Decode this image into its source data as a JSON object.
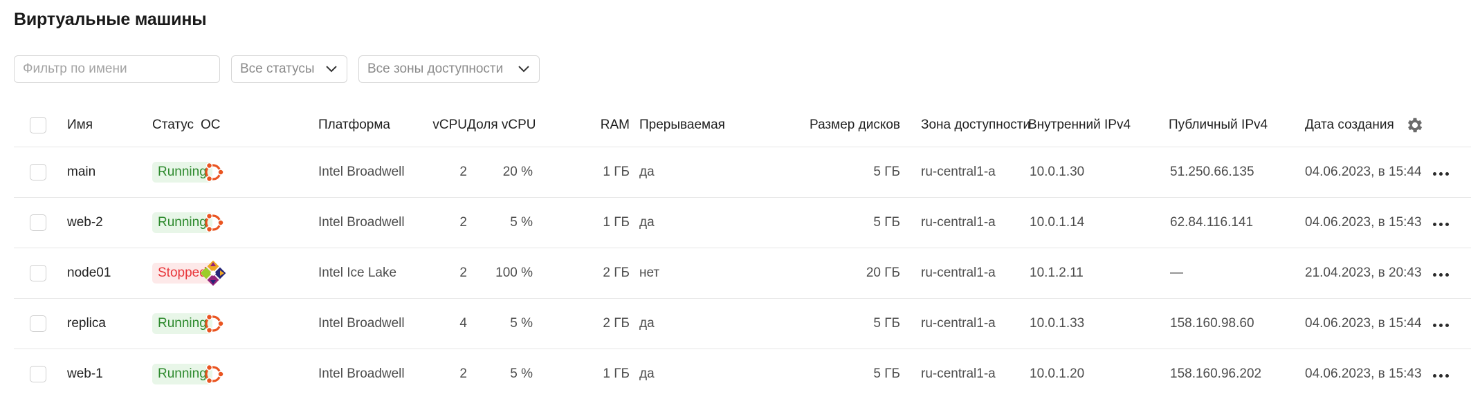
{
  "page_title": "Виртуальные машины",
  "filters": {
    "name_placeholder": "Фильтр по имени",
    "status_label": "Все статусы",
    "zone_label": "Все зоны доступности"
  },
  "columns": {
    "name": "Имя",
    "status": "Статус",
    "os": "ОС",
    "platform": "Платформа",
    "vcpu": "vCPU",
    "vcpu_share": "Доля vCPU",
    "ram": "RAM",
    "preemptible": "Прерываемая",
    "disk_size": "Размер дисков",
    "zone": "Зона доступности",
    "internal_ip": "Внутренний IPv4",
    "public_ip": "Публичный IPv4",
    "created": "Дата создания"
  },
  "colors": {
    "running_bg": "#e8f6e8",
    "running_text": "#2d8a2d",
    "stopped_bg": "#fde9e9",
    "stopped_text": "#e8363a",
    "ubuntu_orange": "#e95420"
  },
  "rows": [
    {
      "name": "main",
      "status": "Running",
      "os": "ubuntu-icon",
      "platform": "Intel Broadwell",
      "vcpu": "2",
      "vcpu_share": "20 %",
      "ram": "1 ГБ",
      "preemptible": "да",
      "disk_size": "5 ГБ",
      "zone": "ru-central1-a",
      "internal_ip": "10.0.1.30",
      "public_ip": "51.250.66.135",
      "created": "04.06.2023, в 15:44"
    },
    {
      "name": "web-2",
      "status": "Running",
      "os": "ubuntu-icon",
      "platform": "Intel Broadwell",
      "vcpu": "2",
      "vcpu_share": "5 %",
      "ram": "1 ГБ",
      "preemptible": "да",
      "disk_size": "5 ГБ",
      "zone": "ru-central1-a",
      "internal_ip": "10.0.1.14",
      "public_ip": "62.84.116.141",
      "created": "04.06.2023, в 15:43"
    },
    {
      "name": "node01",
      "status": "Stopped",
      "os": "centos-icon",
      "platform": "Intel Ice Lake",
      "vcpu": "2",
      "vcpu_share": "100 %",
      "ram": "2 ГБ",
      "preemptible": "нет",
      "disk_size": "20 ГБ",
      "zone": "ru-central1-a",
      "internal_ip": "10.1.2.11",
      "public_ip": "—",
      "created": "21.04.2023, в 20:43"
    },
    {
      "name": "replica",
      "status": "Running",
      "os": "ubuntu-icon",
      "platform": "Intel Broadwell",
      "vcpu": "4",
      "vcpu_share": "5 %",
      "ram": "2 ГБ",
      "preemptible": "да",
      "disk_size": "5 ГБ",
      "zone": "ru-central1-a",
      "internal_ip": "10.0.1.33",
      "public_ip": "158.160.98.60",
      "created": "04.06.2023, в 15:44"
    },
    {
      "name": "web-1",
      "status": "Running",
      "os": "ubuntu-icon",
      "platform": "Intel Broadwell",
      "vcpu": "2",
      "vcpu_share": "5 %",
      "ram": "1 ГБ",
      "preemptible": "да",
      "disk_size": "5 ГБ",
      "zone": "ru-central1-a",
      "internal_ip": "10.0.1.20",
      "public_ip": "158.160.96.202",
      "created": "04.06.2023, в 15:43"
    }
  ]
}
